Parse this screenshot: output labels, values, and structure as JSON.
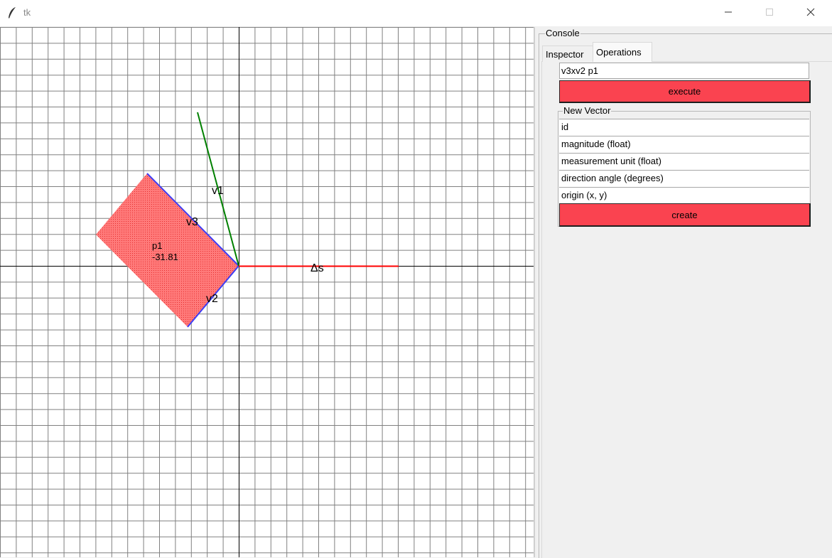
{
  "window": {
    "title": "tk"
  },
  "canvas": {
    "labels": {
      "v1": "v1",
      "v2": "v2",
      "v3": "v3",
      "p1_name": "p1",
      "p1_value": "-31.81",
      "delta_s": "Δs"
    },
    "colors": {
      "grid": "#808080",
      "axis": "#000000",
      "v1": "#008000",
      "v2": "#3d3df5",
      "v3": "#3d3df5",
      "delta_s": "#ff0000",
      "parallelogram_fill": "#ff6b6b"
    }
  },
  "console": {
    "legend": "Console",
    "tabs": [
      {
        "label": "Inspector",
        "selected": false
      },
      {
        "label": "Operations",
        "selected": true
      }
    ],
    "command_input": {
      "value": "v3xv2 p1"
    },
    "execute_label": "execute",
    "new_vector": {
      "legend": "New Vector",
      "fields": [
        {
          "placeholder": "id"
        },
        {
          "placeholder": "magnitude (float)"
        },
        {
          "placeholder": "measurement unit (float)"
        },
        {
          "placeholder": "direction angle (degrees)"
        },
        {
          "placeholder": "origin (x, y)"
        }
      ],
      "create_label": "create"
    },
    "button_color": "#fa4350"
  }
}
